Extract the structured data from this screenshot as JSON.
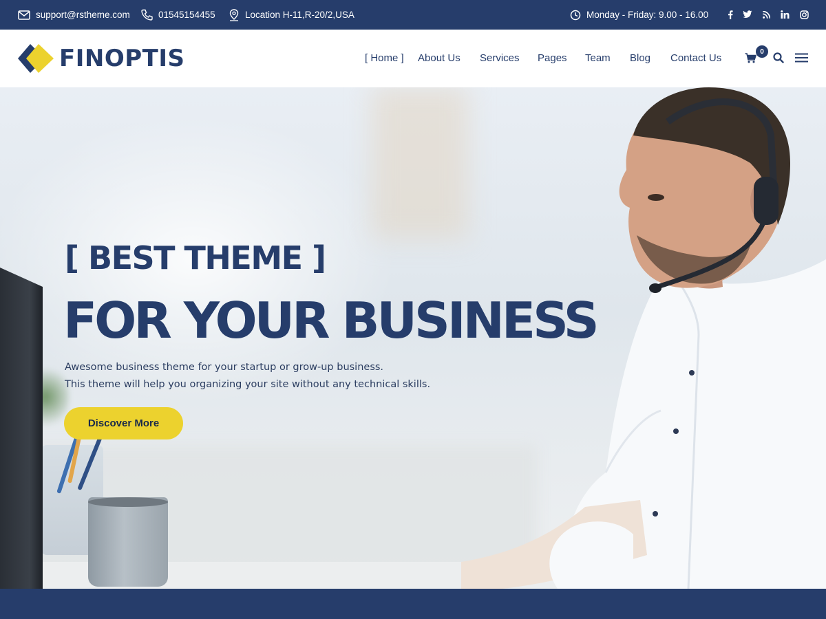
{
  "topbar": {
    "email": "support@rstheme.com",
    "phone": "01545154455",
    "location": "Location H-11,R-20/2,USA",
    "hours": "Monday - Friday: 9.00 - 16.00",
    "social": [
      {
        "icon": "facebook-icon",
        "glyph": "f"
      },
      {
        "icon": "twitter-icon",
        "glyph": "t"
      },
      {
        "icon": "rss-icon",
        "glyph": "rss"
      },
      {
        "icon": "linkedin-icon",
        "glyph": "in"
      },
      {
        "icon": "instagram-icon",
        "glyph": "ig"
      }
    ]
  },
  "header": {
    "logo_text": "FINOPTIS",
    "nav": {
      "home": "[ Home ]",
      "about": "About Us",
      "services": "Services",
      "pages": "Pages",
      "team": "Team",
      "blog": "Blog",
      "contact": "Contact Us"
    },
    "cart_count": "0"
  },
  "hero": {
    "tagline": "[ BEST THEME ]",
    "headline": "FOR YOUR BUSINESS",
    "desc_line1": "Awesome business theme for your startup or grow-up business.",
    "desc_line2": "This theme will help you organizing your site without any technical skills.",
    "cta_label": "Discover More"
  },
  "colors": {
    "primary": "#263d6b",
    "accent": "#ecd22e",
    "white": "#ffffff"
  }
}
